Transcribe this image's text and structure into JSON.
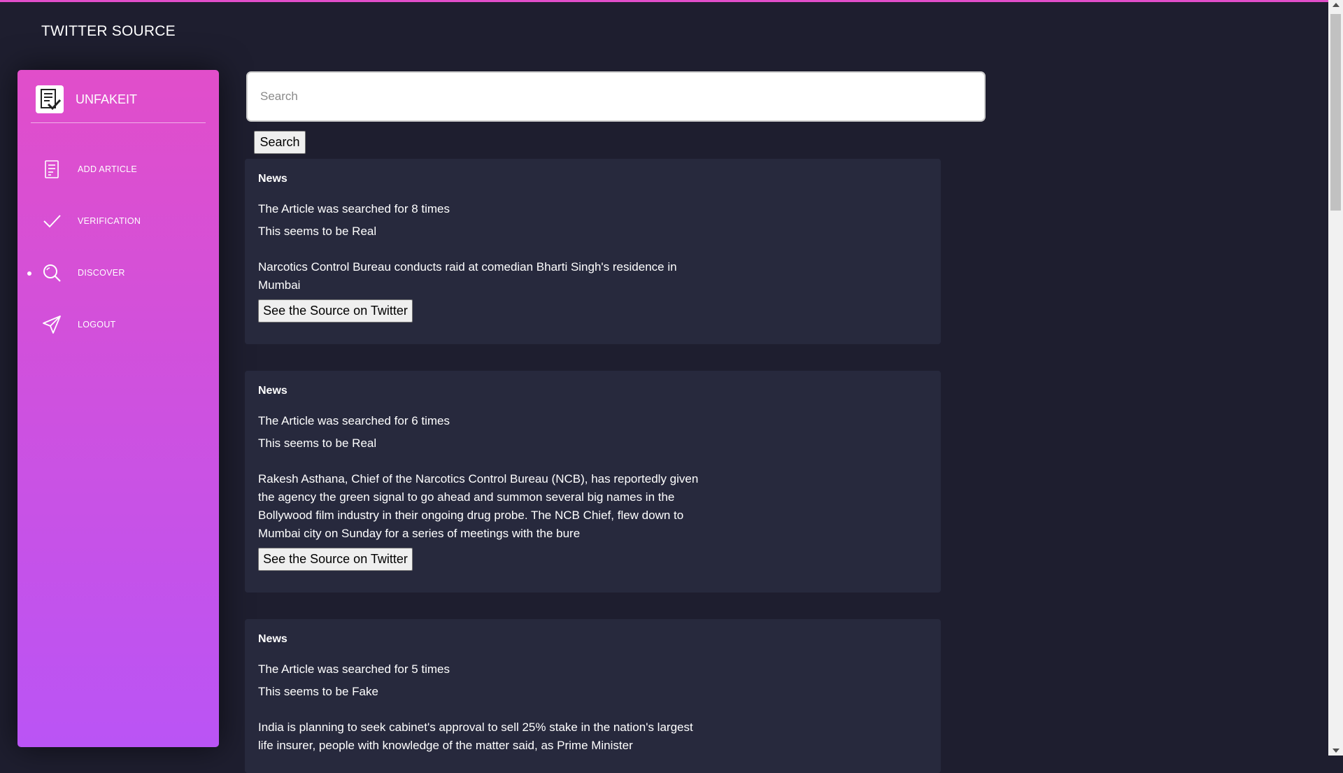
{
  "page": {
    "title": "TWITTER SOURCE"
  },
  "colors": {
    "background": "#1e1e2f",
    "accent": "#e14eca",
    "sidebar_gradient_end": "#ba54f5",
    "card": "#27293d"
  },
  "sidebar": {
    "brand": "UNFAKEIT",
    "brand_icon": "checklist-logo-icon",
    "items": [
      {
        "label": "ADD ARTICLE",
        "icon": "article-icon",
        "active": false
      },
      {
        "label": "VERIFICATION",
        "icon": "checkmark-icon",
        "active": false
      },
      {
        "label": "DISCOVER",
        "icon": "search-icon",
        "active": true
      },
      {
        "label": "LOGOUT",
        "icon": "paper-plane-icon",
        "active": false
      }
    ]
  },
  "search": {
    "placeholder": "Search",
    "value": "",
    "button_label": "Search"
  },
  "articles": [
    {
      "category": "News",
      "searched": "The Article was searched for 8 times",
      "verdict": "This seems to be Real",
      "text": "Narcotics Control Bureau conducts raid at comedian Bharti Singh's residence in Mumbai",
      "button": "See the Source on Twitter"
    },
    {
      "category": "News",
      "searched": "The Article was searched for 6 times",
      "verdict": "This seems to be Real",
      "text": "Rakesh Asthana, Chief of the Narcotics Control Bureau (NCB), has reportedly given the agency the green signal to go ahead and summon several big names in the Bollywood film industry in their ongoing drug probe. The NCB Chief, flew down to Mumbai city on Sunday for a series of meetings with the bure",
      "button": "See the Source on Twitter"
    },
    {
      "category": "News",
      "searched": "The Article was searched for 5 times",
      "verdict": "This seems to be Fake",
      "text": "India is planning to seek cabinet's approval to sell 25% stake in the nation's largest life insurer, people with knowledge of the matter said, as Prime Minister",
      "button": "See the Source on Twitter"
    }
  ]
}
